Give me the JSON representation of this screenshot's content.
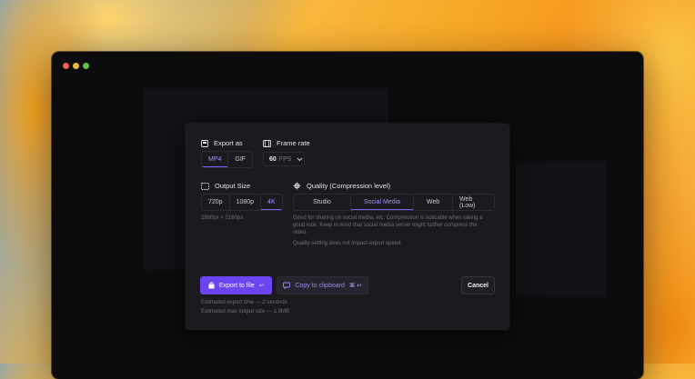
{
  "export_as": {
    "label": "Export as",
    "options": [
      "MP4",
      "GIF"
    ],
    "selected": "MP4"
  },
  "frame_rate": {
    "label": "Frame rate",
    "value": "60",
    "unit": "FPS"
  },
  "output_size": {
    "label": "Output Size",
    "options": [
      "720p",
      "1080p",
      "4K"
    ],
    "selected": "4K",
    "dimensions": "2880px × 2160px"
  },
  "quality": {
    "label": "Quality (Compression level)",
    "options": [
      "Studio",
      "Social Media",
      "Web",
      "Web (Low)"
    ],
    "selected": "Social Media",
    "description": "Good for sharing on social media, etc. Compression is noticable when taking a good look. Keep in mind that social media server might further compress the video.",
    "note": "Quality setting does not impact export speed."
  },
  "actions": {
    "export_label": "Export to file",
    "export_shortcut": "↩",
    "copy_label": "Copy to clipboard",
    "copy_shortcut": "⌘ ↩",
    "cancel_label": "Cancel"
  },
  "estimates": {
    "time": "Estimated export time — 2 seconds",
    "size": "Estimated max output size — 1.8MB"
  },
  "colors": {
    "accent": "#6a45f0",
    "accent_text": "#a98bff"
  }
}
